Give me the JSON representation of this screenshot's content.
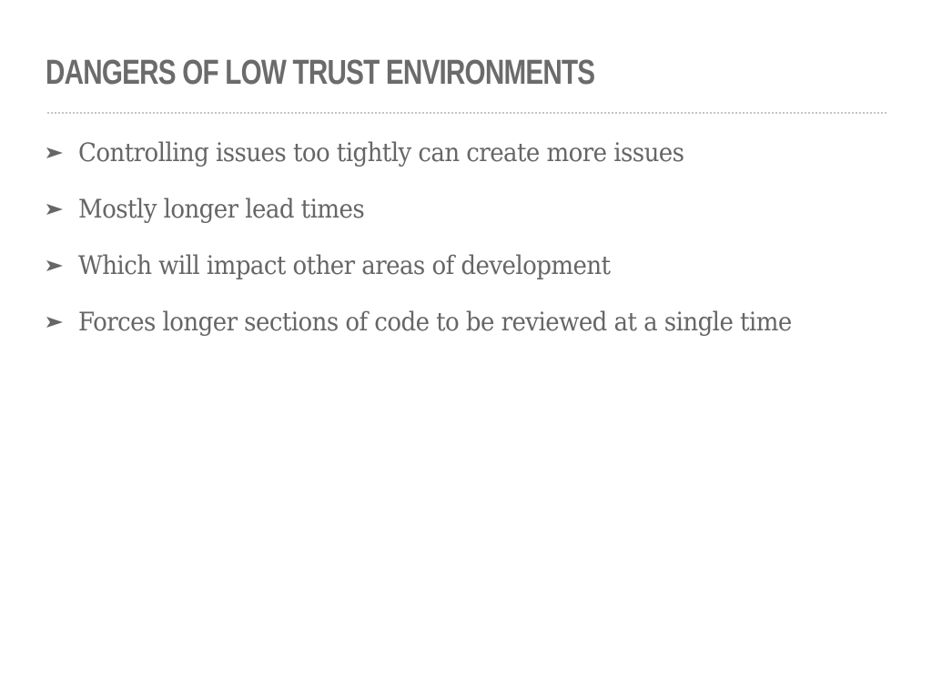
{
  "slide": {
    "title": "DANGERS OF LOW TRUST ENVIRONMENTS",
    "bullet_icon": "arrowhead-bullet-icon",
    "text_color": "#666666",
    "rule_color": "#c4c4c4",
    "bullets": [
      "Controlling issues too tightly can create more issues",
      "Mostly longer lead times",
      "Which will impact other areas of development",
      "Forces longer sections of code to be reviewed at a single time"
    ]
  }
}
